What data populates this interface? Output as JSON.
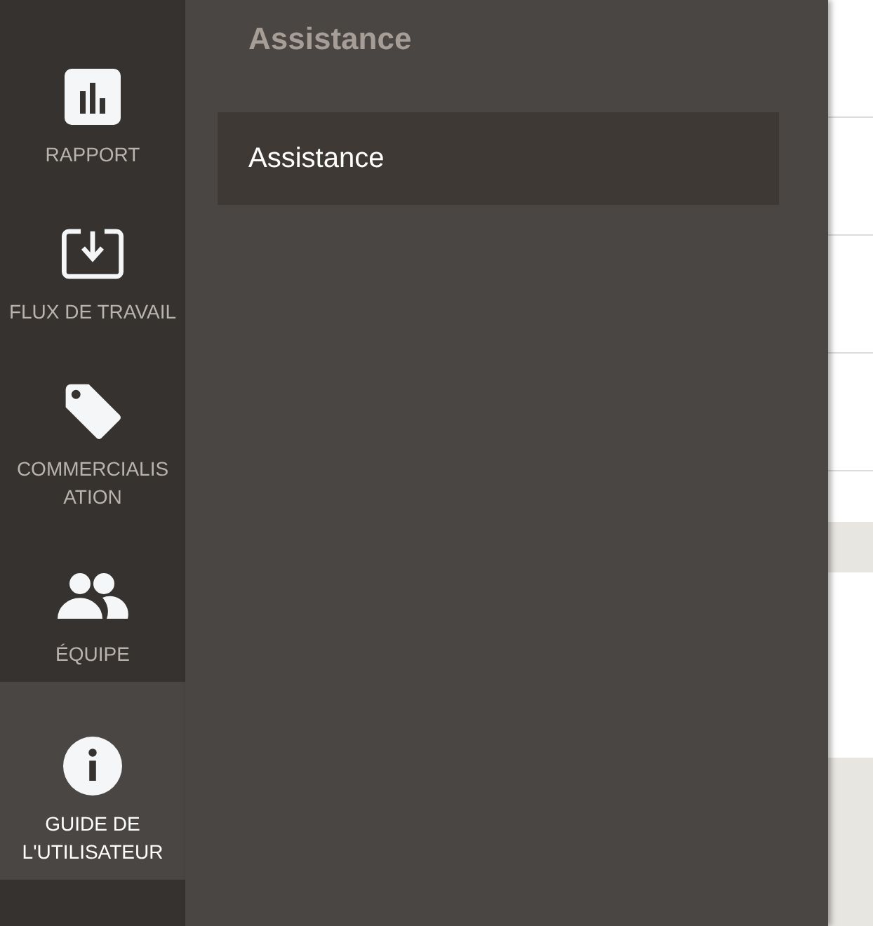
{
  "sidebar": {
    "items": [
      {
        "kind": "report",
        "label": "RAPPORT",
        "selected": false
      },
      {
        "kind": "workflow",
        "label": "FLUX DE TRAVAIL",
        "selected": false
      },
      {
        "kind": "marketing",
        "label": "COMMERCIALIS ATION",
        "selected": false
      },
      {
        "kind": "team",
        "label": "ÉQUIPE",
        "selected": false
      },
      {
        "kind": "guide",
        "label": "GUIDE DE L'UTILISATEUR",
        "selected": true
      }
    ]
  },
  "panel": {
    "title": "Assistance",
    "items": [
      {
        "label": "Assistance",
        "selected": true
      }
    ]
  }
}
